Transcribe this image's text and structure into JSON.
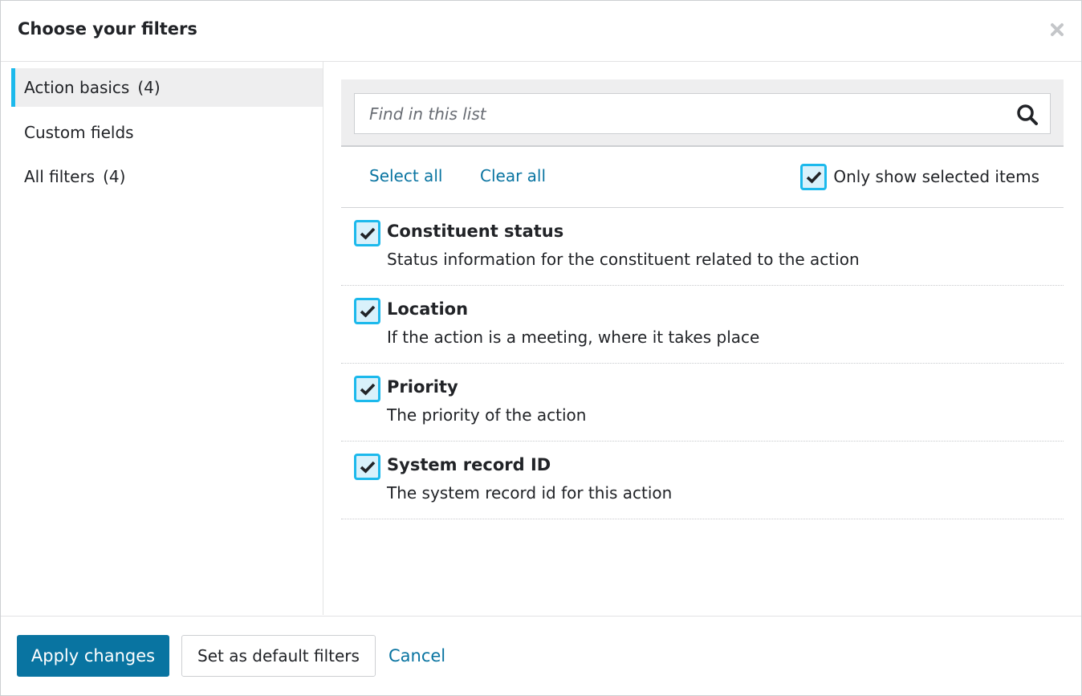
{
  "header": {
    "title": "Choose your filters",
    "close_icon": "close-icon"
  },
  "sidebar": {
    "items": [
      {
        "label": "Action basics",
        "count": "(4)",
        "active": true
      },
      {
        "label": "Custom fields",
        "count": "",
        "active": false
      },
      {
        "label": "All filters",
        "count": "(4)",
        "active": false
      }
    ]
  },
  "search": {
    "placeholder": "Find in this list",
    "value": "",
    "icon": "search-icon"
  },
  "toolbar": {
    "select_all": "Select all",
    "clear_all": "Clear all",
    "only_show_selected": "Only show selected items",
    "only_show_selected_checked": true
  },
  "list": {
    "items": [
      {
        "title": "Constituent status",
        "description": "Status information for the constituent related to the action",
        "checked": true
      },
      {
        "title": "Location",
        "description": "If the action is a meeting, where it takes place",
        "checked": true
      },
      {
        "title": "Priority",
        "description": "The priority of the action",
        "checked": true
      },
      {
        "title": "System record ID",
        "description": "The system record id for this action",
        "checked": true
      }
    ]
  },
  "footer": {
    "apply": "Apply changes",
    "set_default": "Set as default filters",
    "cancel": "Cancel"
  },
  "colors": {
    "accent": "#0974a1",
    "checkbox_border": "#1cb9ec",
    "active_indicator": "#1cb9ec"
  }
}
